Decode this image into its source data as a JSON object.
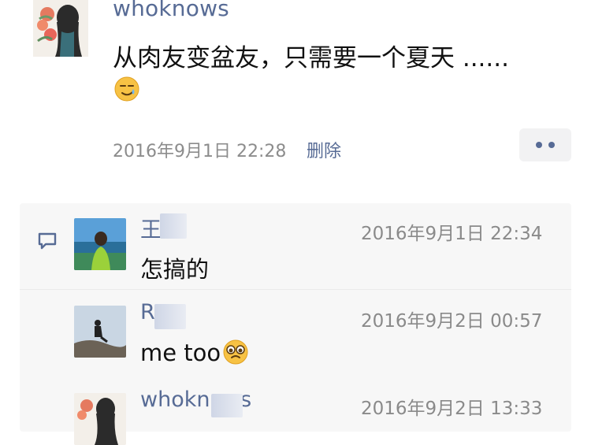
{
  "post": {
    "username": "whoknows",
    "text": "从肉友变盆友，只需要一个夏天 ......",
    "emoji": "smirk-emoji",
    "timestamp": "2016年9月1日 22:28",
    "delete_label": "删除",
    "more_icon": "more-dots-icon"
  },
  "comments": [
    {
      "name": "王",
      "time": "2016年9月1日 22:34",
      "text": "怎搞的"
    },
    {
      "name": "R",
      "time": "2016年9月2日 00:57",
      "text": "me too",
      "emoji": "pleading-face-emoji"
    },
    {
      "name": "whoknows",
      "time": "2016年9月2日 13:33"
    }
  ],
  "colors": {
    "link": "#576b95",
    "muted": "#8a8a8a",
    "panel": "#f7f7f7"
  }
}
